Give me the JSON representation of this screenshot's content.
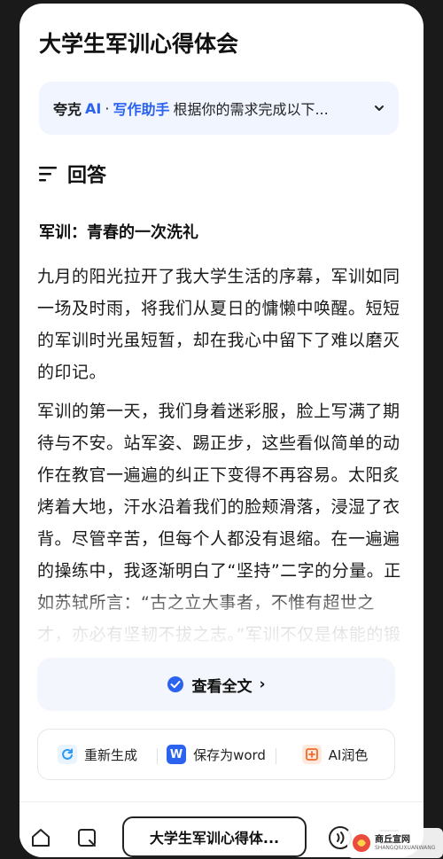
{
  "page": {
    "title": "大学生军训心得体会"
  },
  "ai_bar": {
    "brand": "夸克",
    "brand_ai": "AI",
    "separator": "·",
    "helper": "写作助手",
    "description": "根据你的需求完成以下..."
  },
  "answer": {
    "heading": "回答",
    "subheading": "军训：青春的一次洗礼",
    "paragraphs": [
      "九月的阳光拉开了我大学生活的序幕，军训如同一场及时雨，将我们从夏日的慵懒中唤醒。短短的军训时光虽短暂，却在我心中留下了难以磨灭的印记。",
      "军训的第一天，我们身着迷彩服，脸上写满了期待与不安。站军姿、踢正步，这些看似简单的动作在教官一遍遍的纠正下变得不再容易。太阳炙烤着大地，汗水沿着我们的脸颊滑落，浸湿了衣背。尽管辛苦，但每个人都没有退缩。在一遍遍的操练中，我逐渐明白了“坚持”二字的分量。正如苏轼所言：“古之立大事者，不惟有超世之才，亦必有坚韧不拔之志。”军训不仅是体能的锻炼，更是意志的磨"
    ]
  },
  "view_all": {
    "label": "查看全文",
    "chevron": "›"
  },
  "actions": [
    {
      "label": "重新生成",
      "icon": "refresh-icon"
    },
    {
      "label": "保存为word",
      "icon": "word-icon",
      "icon_text": "W"
    },
    {
      "label": "AI润色",
      "icon": "polish-icon"
    }
  ],
  "bottom_nav": {
    "query_label": "大学生军训心得体..."
  },
  "watermark": {
    "text": "商丘宣网",
    "sub": "SHANGQIUXUANWANG"
  },
  "colors": {
    "accent": "#2b62f0",
    "ai_bar_bg": "#f0f5ff",
    "view_all_bg": "#f3f6fc"
  }
}
